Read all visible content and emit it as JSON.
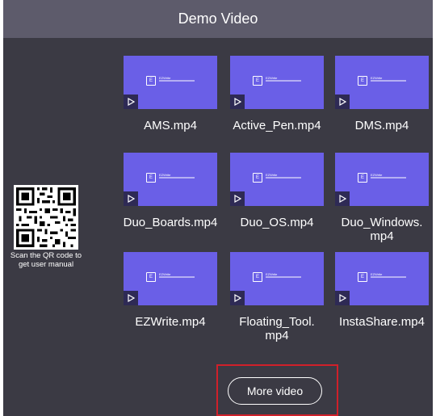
{
  "header": {
    "title": "Demo Video"
  },
  "qr": {
    "caption": "Scan the QR code to get user manual",
    "icon": "qr-code-icon"
  },
  "thumbnail": {
    "brand": "EZWrite",
    "logo_letters": "E"
  },
  "videos": [
    {
      "label": "AMS.mp4"
    },
    {
      "label": "Active_Pen.mp4"
    },
    {
      "label": "DMS.mp4"
    },
    {
      "label": "Duo_Boards.mp4"
    },
    {
      "label": "Duo_OS.mp4"
    },
    {
      "label": "Duo_Windows.\nmp4"
    },
    {
      "label": "EZWrite.mp4"
    },
    {
      "label": "Floating_Tool.\nmp4"
    },
    {
      "label": "InstaShare.mp4"
    }
  ],
  "footer": {
    "more_label": "More video"
  },
  "colors": {
    "titlebar": "#5d5b6b",
    "panel": "#3b3a44",
    "thumb": "#6a5fe7",
    "highlight": "#d0202a"
  }
}
